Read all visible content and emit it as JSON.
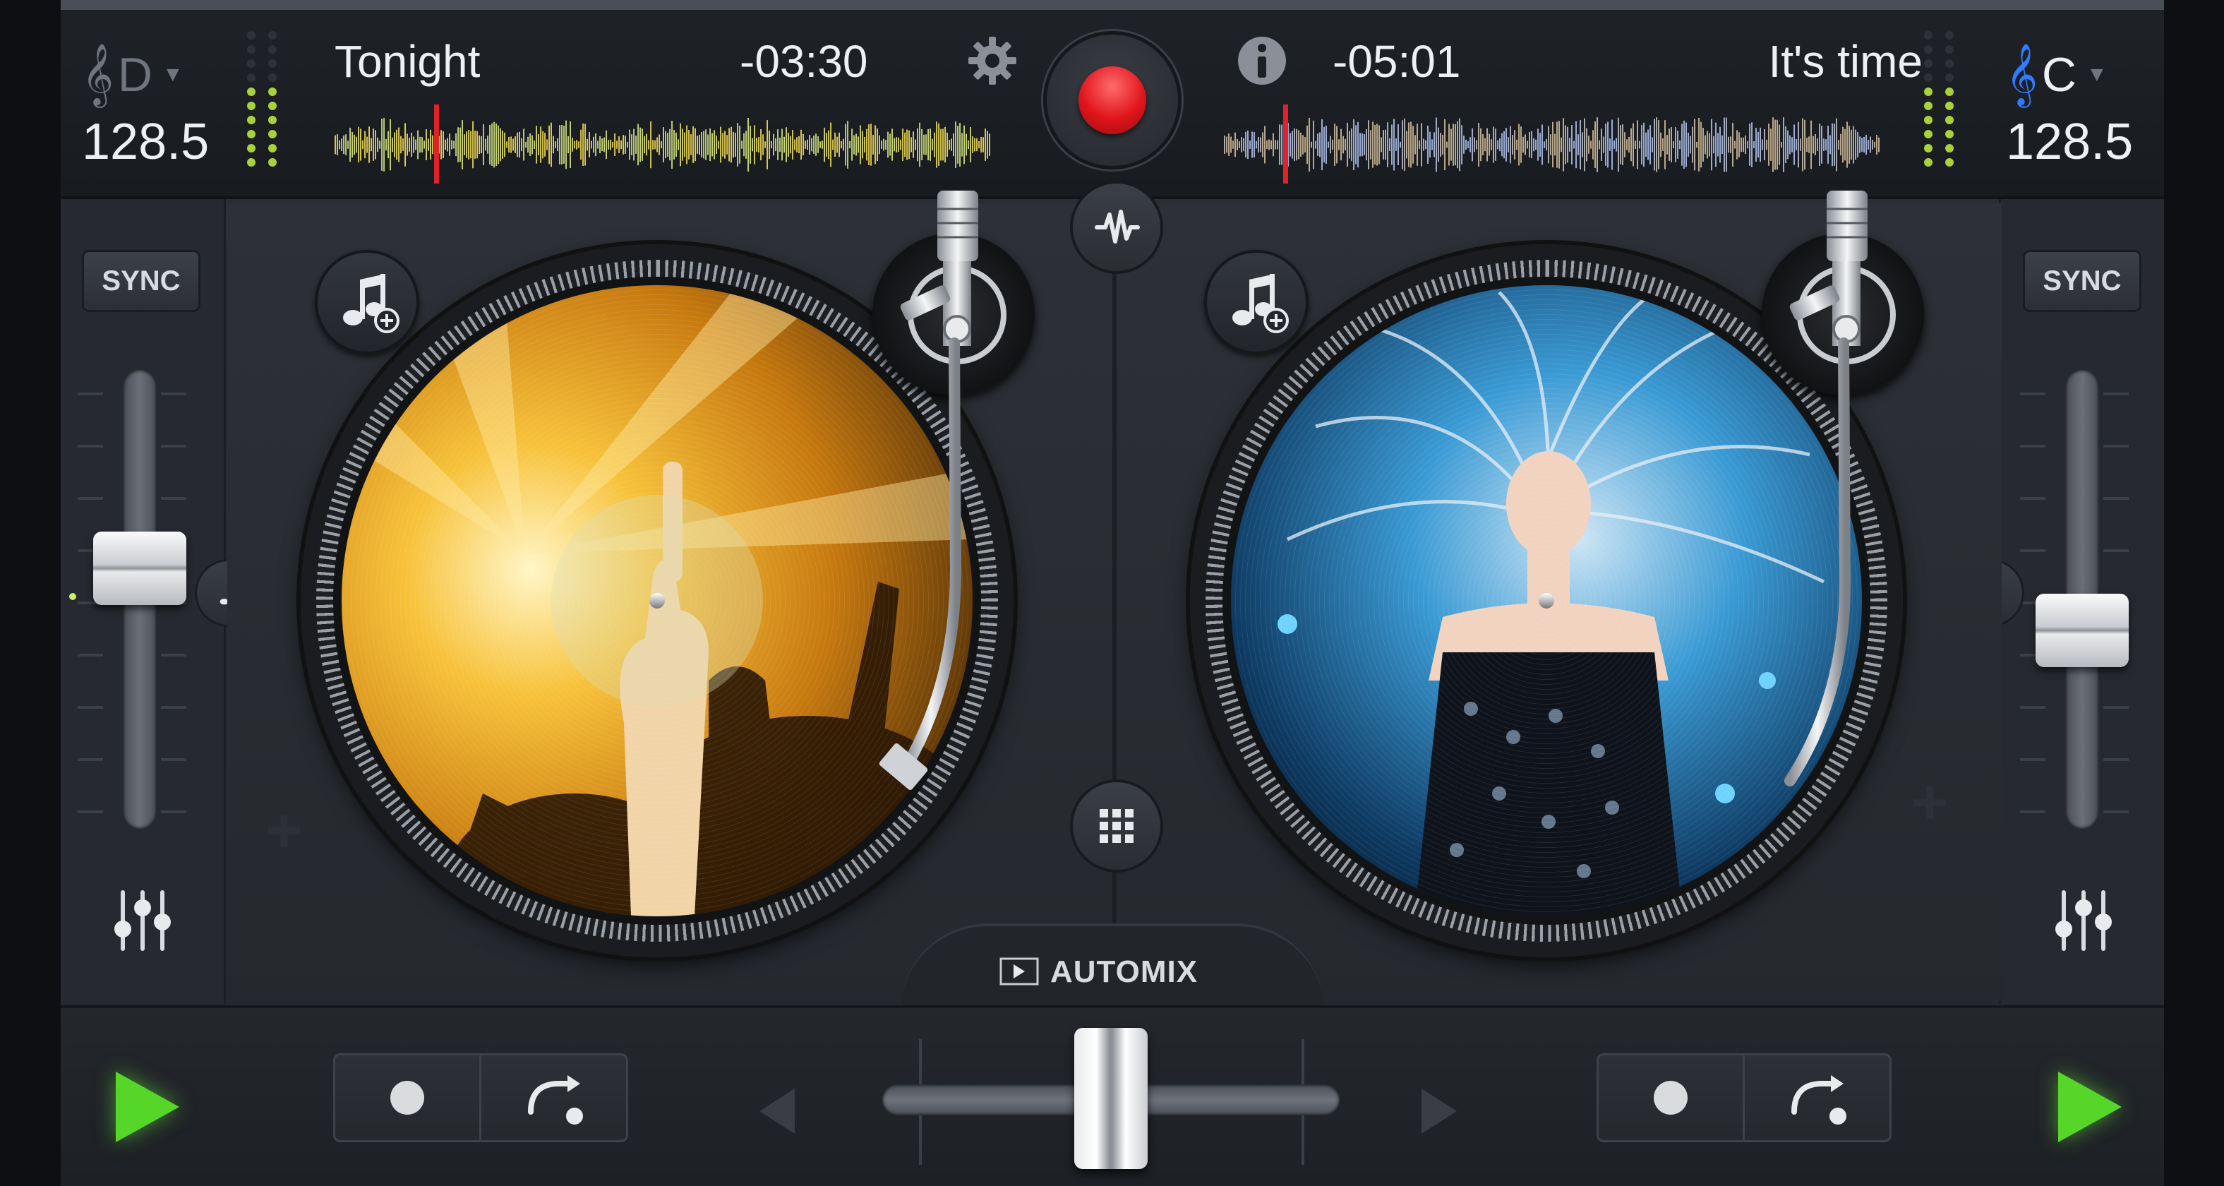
{
  "colors": {
    "accent_record": "#e0151c",
    "play_green": "#57d62a",
    "key_clef_right": "#2f7cff",
    "playhead": "#e0222a",
    "background": "#2a2e35"
  },
  "deck_left": {
    "key": "D",
    "key_icon": "treble-clef-icon",
    "bpm": "128.5",
    "title": "Tonight",
    "time_remaining": "-03:30",
    "sync_label": "SYNC",
    "pitch_position": 0.42,
    "playhead_position": 0.15,
    "cue_icon": "cue-dot-icon",
    "loop_icon": "loop-arrow-icon",
    "play_icon": "play-icon"
  },
  "deck_right": {
    "key": "C",
    "key_icon": "treble-clef-icon",
    "bpm": "128.5",
    "title": "It's time",
    "time_remaining": "-05:01",
    "sync_label": "SYNC",
    "pitch_position": 0.58,
    "playhead_position": 0.09,
    "cue_icon": "cue-dot-icon",
    "loop_icon": "loop-arrow-icon",
    "play_icon": "play-icon"
  },
  "center": {
    "record_icon": "record-icon",
    "settings_icon": "gear-icon",
    "info_icon": "info-icon",
    "waveform_toggle_icon": "waveform-icon",
    "grid_icon": "grid-icon",
    "automix_label": "AUTOMIX",
    "crossfader_position": 0.5
  }
}
